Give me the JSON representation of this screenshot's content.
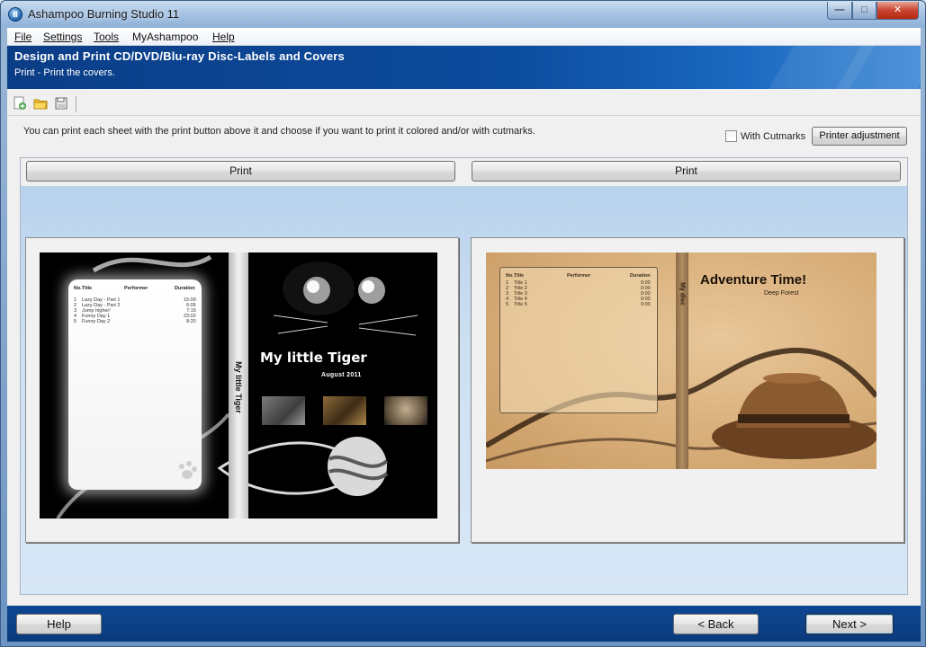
{
  "window": {
    "title": "Ashampoo Burning Studio 11",
    "app_icon_glyph": "Ⅱ",
    "min_glyph": "—",
    "max_glyph": "□",
    "close_glyph": "✕"
  },
  "menu": {
    "items": [
      {
        "label": "File"
      },
      {
        "label": "Settings"
      },
      {
        "label": "Tools"
      },
      {
        "label": "MyAshampoo"
      },
      {
        "label": "Help"
      }
    ]
  },
  "banner": {
    "title": "Design and Print CD/DVD/Blu-ray Disc-Labels and Covers",
    "subtitle": "Print - Print the covers."
  },
  "toolbar": {
    "icons": [
      "new-icon",
      "open-folder-icon",
      "save-icon"
    ]
  },
  "info_text": "You can print each sheet with the print button above it and choose if you want to print it colored and/or with cutmarks.",
  "cutmarks_label": "With Cutmarks",
  "printer_adjustment_label": "Printer adjustment",
  "print_buttons": [
    "Print",
    "Print"
  ],
  "cover1": {
    "columns": [
      "No.Title",
      "Performer",
      "Duration"
    ],
    "tracks": [
      {
        "no": "1",
        "title": "Lazy Day - Part 1",
        "duration": "15:00"
      },
      {
        "no": "2",
        "title": "Lazy Day - Part 2",
        "duration": "6:05"
      },
      {
        "no": "3",
        "title": "Jump higher!",
        "duration": "7:15"
      },
      {
        "no": "4",
        "title": "Funny Day 1",
        "duration": "23:02"
      },
      {
        "no": "5",
        "title": "Funny Day 2",
        "duration": "8:20"
      }
    ],
    "spine_text": "My little Tiger",
    "title": "My little Tiger",
    "date": "August 2011"
  },
  "cover2": {
    "columns": [
      "No.Title",
      "Performer",
      "Duration"
    ],
    "tracks": [
      {
        "no": "1",
        "title": "Title 1",
        "duration": "0:00"
      },
      {
        "no": "2",
        "title": "Title 2",
        "duration": "0:00"
      },
      {
        "no": "3",
        "title": "Title 3",
        "duration": "0:00"
      },
      {
        "no": "4",
        "title": "Title 4",
        "duration": "0:00"
      },
      {
        "no": "5",
        "title": "Title 5",
        "duration": "0:00"
      }
    ],
    "spine_text": "My disc",
    "title": "Adventure Time!",
    "subtitle": "Deep Forest"
  },
  "bottom": {
    "help_label": "Help",
    "back_label": "< Back",
    "next_label": "Next >"
  }
}
